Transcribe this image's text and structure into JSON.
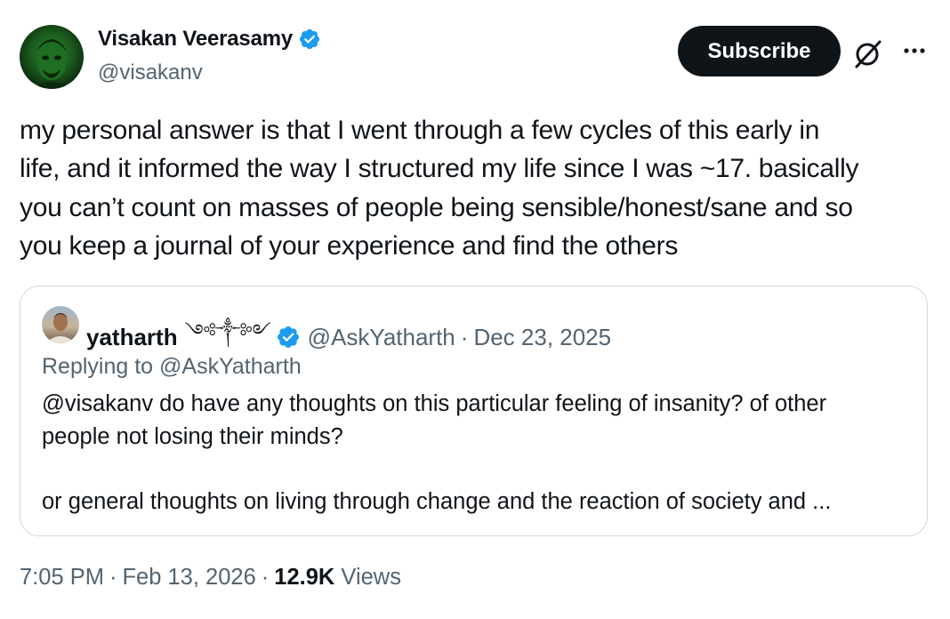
{
  "author": {
    "name": "Visakan Veerasamy",
    "handle": "@visakanv",
    "verified_color": "#1d9bf0"
  },
  "actions": {
    "subscribe_label": "Subscribe",
    "grok_icon": "grok-icon",
    "more_icon": "more-icon"
  },
  "tweet": {
    "text": "my personal answer is that I went through a few cycles of this early in\nlife, and it informed the way I structured my life since I was ~17. basically\nyou can’t count on masses of people being sensible/honest/sane and so\nyou keep a journal of your experience and find the others"
  },
  "quote": {
    "name": "yatharth",
    "name_decoration": "༺༒༻",
    "handle": "@AskYatharth",
    "separator": "·",
    "date": "Dec 23, 2025",
    "replying_to": "Replying to @AskYatharth",
    "text": "@visakanv do have any thoughts on this particular feeling of insanity? of other\npeople not losing their minds?\n\nor general thoughts on living through change and the reaction of society and ..."
  },
  "meta": {
    "time": "7:05 PM",
    "separator": "·",
    "date": "Feb 13, 2026",
    "views_count": "12.9K",
    "views_label": "Views"
  },
  "colors": {
    "text_primary": "#0f1419",
    "text_secondary": "#536471",
    "border": "#cfd9de",
    "button_bg": "#0f1419"
  }
}
